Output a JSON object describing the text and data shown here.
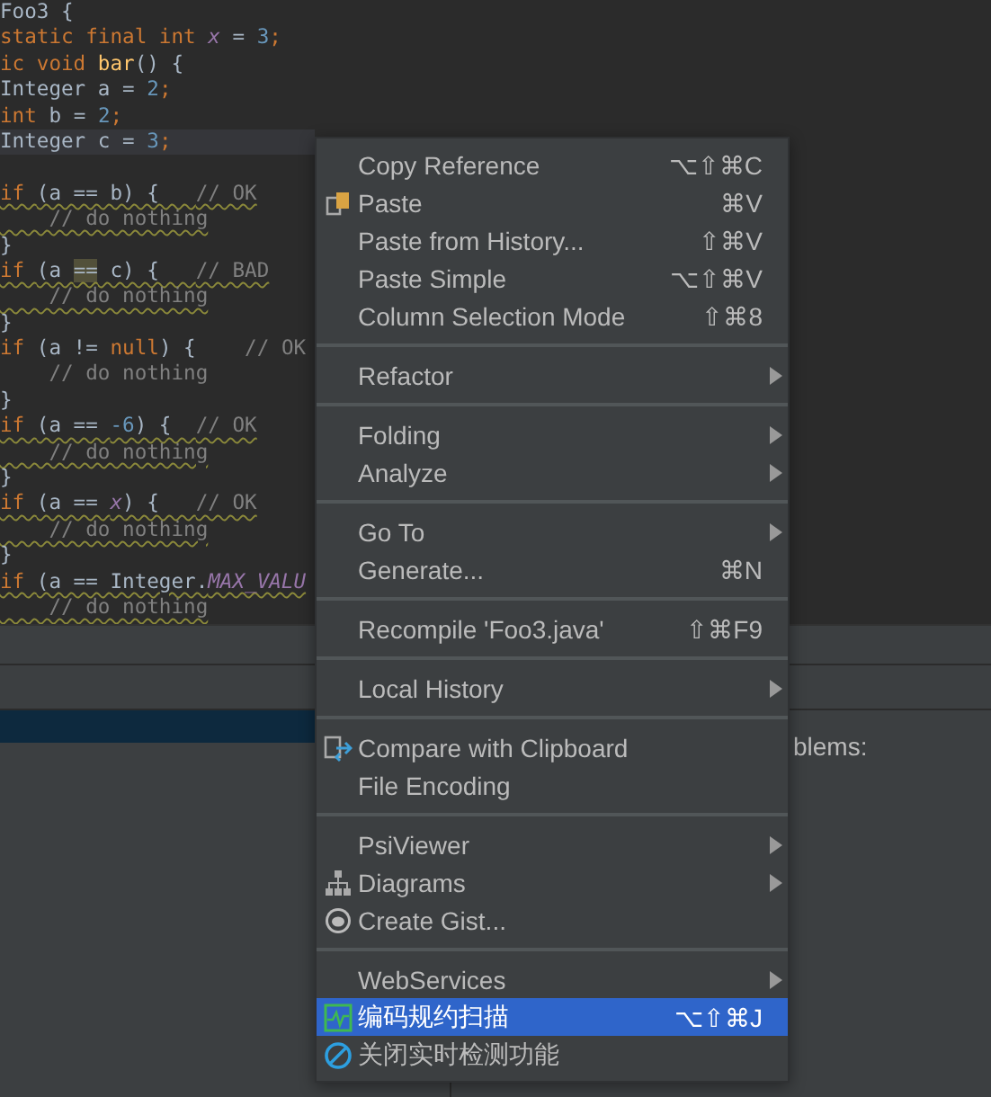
{
  "editor": {
    "lines": [
      {
        "current": false,
        "warning": false,
        "tokens": [
          {
            "text": "Foo3 {",
            "kind": "plain"
          }
        ]
      },
      {
        "current": false,
        "warning": false,
        "tokens": [
          {
            "text": "static final int ",
            "kind": "keyword"
          },
          {
            "text": "x",
            "kind": "field"
          },
          {
            "text": " = ",
            "kind": "plain"
          },
          {
            "text": "3",
            "kind": "number"
          },
          {
            "text": ";",
            "kind": "keyword"
          }
        ]
      },
      {
        "current": false,
        "warning": false,
        "tokens": [
          {
            "text": "ic void ",
            "kind": "keyword"
          },
          {
            "text": "bar",
            "kind": "method"
          },
          {
            "text": "() {",
            "kind": "plain"
          }
        ]
      },
      {
        "current": false,
        "warning": false,
        "tokens": [
          {
            "text": "Integer a = ",
            "kind": "plain"
          },
          {
            "text": "2",
            "kind": "number"
          },
          {
            "text": ";",
            "kind": "keyword"
          }
        ]
      },
      {
        "current": false,
        "warning": false,
        "tokens": [
          {
            "text": "int ",
            "kind": "keyword"
          },
          {
            "text": "b = ",
            "kind": "plain"
          },
          {
            "text": "2",
            "kind": "number"
          },
          {
            "text": ";",
            "kind": "keyword"
          }
        ]
      },
      {
        "current": true,
        "warning": false,
        "tokens": [
          {
            "text": "Integer c = ",
            "kind": "plain"
          },
          {
            "text": "3",
            "kind": "number"
          },
          {
            "text": ";",
            "kind": "keyword"
          }
        ]
      },
      {
        "current": false
      },
      {
        "current": false,
        "warning": true,
        "tokens": [
          {
            "text": "if ",
            "kind": "keyword"
          },
          {
            "text": "(a == b) {   ",
            "kind": "plain"
          },
          {
            "text": "// OK",
            "kind": "comment"
          }
        ]
      },
      {
        "current": false,
        "warning": true,
        "tokens": [
          {
            "text": "    // do nothing",
            "kind": "comment"
          }
        ]
      },
      {
        "current": false,
        "warning": false,
        "tokens": [
          {
            "text": "}",
            "kind": "plain"
          }
        ]
      },
      {
        "current": false,
        "warning": true,
        "tokens": [
          {
            "text": "if ",
            "kind": "keyword"
          },
          {
            "text": "(a ",
            "kind": "plain"
          },
          {
            "text": "==",
            "kind": "highlight"
          },
          {
            "text": " c) {   ",
            "kind": "plain"
          },
          {
            "text": "// BAD",
            "kind": "comment"
          }
        ]
      },
      {
        "current": false,
        "warning": true,
        "tokens": [
          {
            "text": "    // do nothing",
            "kind": "comment"
          }
        ]
      },
      {
        "current": false,
        "warning": false,
        "tokens": [
          {
            "text": "}",
            "kind": "plain"
          }
        ]
      },
      {
        "current": false,
        "warning": false,
        "tokens": [
          {
            "text": "if ",
            "kind": "keyword"
          },
          {
            "text": "(a != ",
            "kind": "plain"
          },
          {
            "text": "null",
            "kind": "keyword"
          },
          {
            "text": ") {    ",
            "kind": "plain"
          },
          {
            "text": "// OK",
            "kind": "comment"
          }
        ]
      },
      {
        "current": false,
        "warning": false,
        "tokens": [
          {
            "text": "    // do nothing",
            "kind": "comment"
          }
        ]
      },
      {
        "current": false,
        "warning": false,
        "tokens": [
          {
            "text": "}",
            "kind": "plain"
          }
        ]
      },
      {
        "current": false,
        "warning": true,
        "tokens": [
          {
            "text": "if ",
            "kind": "keyword"
          },
          {
            "text": "(a == ",
            "kind": "plain"
          },
          {
            "text": "-6",
            "kind": "number"
          },
          {
            "text": ") {  ",
            "kind": "plain"
          },
          {
            "text": "// OK",
            "kind": "comment"
          }
        ]
      },
      {
        "current": false,
        "warning": true,
        "tokens": [
          {
            "text": "    // do nothing",
            "kind": "comment"
          }
        ]
      },
      {
        "current": false,
        "warning": false,
        "tokens": [
          {
            "text": "}",
            "kind": "plain"
          }
        ]
      },
      {
        "current": false,
        "warning": true,
        "tokens": [
          {
            "text": "if ",
            "kind": "keyword"
          },
          {
            "text": "(a == ",
            "kind": "plain"
          },
          {
            "text": "x",
            "kind": "field"
          },
          {
            "text": ") {   ",
            "kind": "plain"
          },
          {
            "text": "// OK",
            "kind": "comment"
          }
        ]
      },
      {
        "current": false,
        "warning": true,
        "tokens": [
          {
            "text": "    // do nothing",
            "kind": "comment"
          }
        ]
      },
      {
        "current": false,
        "warning": false,
        "tokens": [
          {
            "text": "}",
            "kind": "plain"
          }
        ]
      },
      {
        "current": false,
        "warning": true,
        "tokens": [
          {
            "text": "if ",
            "kind": "keyword"
          },
          {
            "text": "(a == Integer.",
            "kind": "plain"
          },
          {
            "text": "MAX_VALU",
            "kind": "field"
          }
        ]
      },
      {
        "current": false,
        "warning": true,
        "tokens": [
          {
            "text": "    // do nothing",
            "kind": "comment"
          }
        ]
      }
    ]
  },
  "problems_panel": {
    "hint": "blems:"
  },
  "context_menu": {
    "items": [
      {
        "kind": "item",
        "label": "Copy Reference",
        "shortcut": "⌥⇧⌘C",
        "submenu": false,
        "selected": false
      },
      {
        "kind": "item",
        "label": "Paste",
        "shortcut": "⌘V",
        "submenu": false,
        "selected": false
      },
      {
        "kind": "item",
        "label": "Paste from History...",
        "shortcut": "⇧⌘V",
        "submenu": false,
        "selected": false
      },
      {
        "kind": "item",
        "label": "Paste Simple",
        "shortcut": "⌥⇧⌘V",
        "submenu": false,
        "selected": false
      },
      {
        "kind": "item",
        "label": "Column Selection Mode",
        "shortcut": "⇧⌘8",
        "submenu": false,
        "selected": false
      },
      {
        "kind": "separator"
      },
      {
        "kind": "item",
        "label": "Refactor",
        "submenu": true,
        "selected": false
      },
      {
        "kind": "separator"
      },
      {
        "kind": "item",
        "label": "Folding",
        "submenu": true,
        "selected": false
      },
      {
        "kind": "item",
        "label": "Analyze",
        "submenu": true,
        "selected": false
      },
      {
        "kind": "separator"
      },
      {
        "kind": "item",
        "label": "Go To",
        "submenu": true,
        "selected": false
      },
      {
        "kind": "item",
        "label": "Generate...",
        "shortcut": "⌘N",
        "submenu": false,
        "selected": false
      },
      {
        "kind": "separator"
      },
      {
        "kind": "item",
        "label": "Recompile 'Foo3.java'",
        "shortcut": "⇧⌘F9",
        "submenu": false,
        "selected": false
      },
      {
        "kind": "separator"
      },
      {
        "kind": "item",
        "label": "Local History",
        "submenu": true,
        "selected": false
      },
      {
        "kind": "separator"
      },
      {
        "kind": "item",
        "label": "Compare with Clipboard",
        "submenu": false,
        "selected": false
      },
      {
        "kind": "item",
        "label": "File Encoding",
        "submenu": false,
        "selected": false
      },
      {
        "kind": "separator"
      },
      {
        "kind": "item",
        "label": "PsiViewer",
        "submenu": true,
        "selected": false
      },
      {
        "kind": "item",
        "label": "Diagrams",
        "submenu": true,
        "selected": false
      },
      {
        "kind": "item",
        "label": "Create Gist...",
        "submenu": false,
        "selected": false
      },
      {
        "kind": "separator"
      },
      {
        "kind": "item",
        "label": "WebServices",
        "submenu": true,
        "selected": false
      },
      {
        "kind": "item",
        "label": "编码规约扫描",
        "shortcut": "⌥⇧⌘J",
        "submenu": false,
        "selected": true
      },
      {
        "kind": "item",
        "label": "关闭实时检测功能",
        "submenu": false,
        "selected": false
      }
    ]
  }
}
